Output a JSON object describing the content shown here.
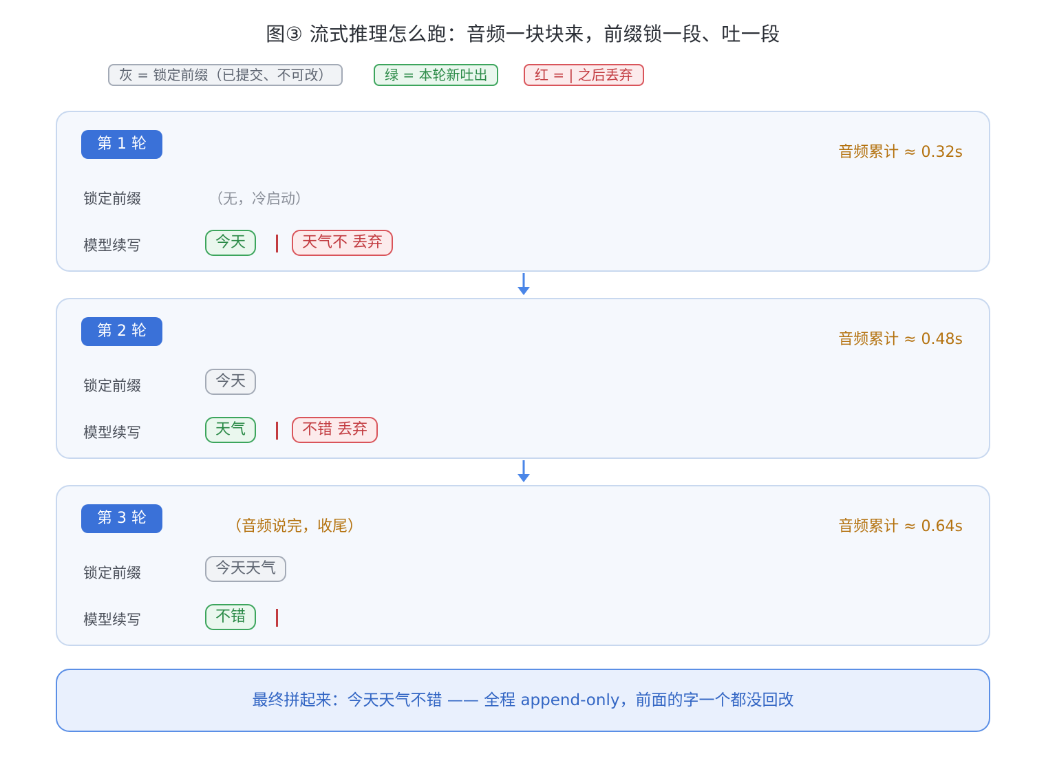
{
  "title": "图③ 流式推理怎么跑：音频一块块来，前缀锁一段、吐一段",
  "legend": {
    "gray": "灰 = 锁定前缀（已提交、不可改）",
    "green": "绿 = 本轮新吐出",
    "red": "红 = | 之后丢弃"
  },
  "row_labels": {
    "prefix": "锁定前缀",
    "model": "模型续写"
  },
  "rounds": [
    {
      "label": "第 1 轮",
      "audio": "音频累计 ≈ 0.32s",
      "note": "",
      "prefix": "",
      "prefix_text": "（无，冷启动）",
      "generated": "今天",
      "discarded": "天气不 丢弃"
    },
    {
      "label": "第 2 轮",
      "audio": "音频累计 ≈ 0.48s",
      "note": "",
      "prefix": "今天",
      "prefix_text": "",
      "generated": "天气",
      "discarded": "不错 丢弃"
    },
    {
      "label": "第 3 轮",
      "audio": "音频累计 ≈ 0.64s",
      "note": "（音频说完，收尾）",
      "prefix": "今天天气",
      "prefix_text": "",
      "generated": "不错",
      "discarded": ""
    }
  ],
  "final": "最终拼起来：今天天气不错 —— 全程 append-only，前面的字一个都没回改",
  "colors": {
    "badge": "#3a71d8",
    "audio": "#b4720f",
    "arrow": "#4a86e8",
    "final_border": "#5b8fe6"
  }
}
